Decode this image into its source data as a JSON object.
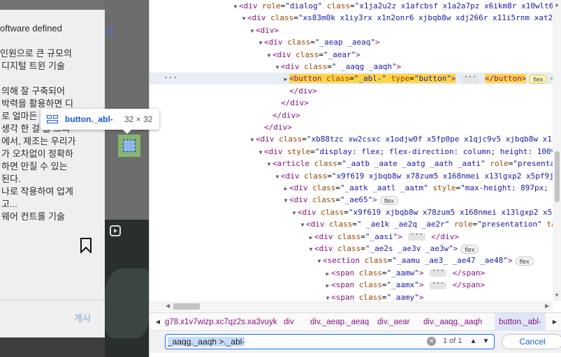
{
  "post": {
    "lines": [
      "oftware defined",
      "인원으로 큰 규모의",
      "디지털 트윈 기술",
      "의해 잘 구축되어",
      "박력을 활용하면 디",
      "로 얼마든",
      "생각 한 걸 을 그리",
      "에서, 제조는 우리가",
      "가 오차없이 정확하",
      "하면 만질 수 있는",
      "된다.",
      "나로 작용하여 업계",
      "고...",
      "웨어 컨트롤 기술"
    ],
    "side_glyph": "에",
    "post_button": "게시"
  },
  "tooltip": {
    "element": "button._abl-",
    "size": "32 × 32"
  },
  "dom": {
    "rows": [
      {
        "indent": 8,
        "tri": "▼",
        "html": "<span class=\"tag\">&lt;div</span> <span class=\"an\">role</span>=<span class=\"av\">\"dialog\"</span> <span class=\"an\">class</span>=<span class=\"av\">\"x1ja2u2z x1afcbsf x1a2a7pz x6ikm8r x10wlt6</span>"
      },
      {
        "indent": 20,
        "tri": "▼",
        "html": "<span class=\"tag\">&lt;div</span> <span class=\"an\">class</span>=<span class=\"av\">\"xs83m0k x1iy3rx x1n2onr6 xjbqb8w xdj266r x11i5rnm xat24</span>"
      },
      {
        "indent": 32,
        "tri": "▼",
        "html": "<span class=\"tag\">&lt;div&gt;</span>"
      },
      {
        "indent": 44,
        "tri": "▼",
        "html": "<span class=\"tag\">&lt;div</span> <span class=\"an\">class</span>=<span class=\"av\">\"_aeap _aeaq\"</span><span class=\"tag\">&gt;</span>"
      },
      {
        "indent": 56,
        "tri": "▼",
        "html": "<span class=\"tag\">&lt;div</span> <span class=\"an\">class</span>=<span class=\"av\">\"_aear\"</span><span class=\"tag\">&gt;</span>"
      },
      {
        "indent": 68,
        "tri": "▼",
        "html": "<span class=\"tag\">&lt;div</span> <span class=\"an\">class</span>=<span class=\"av\">\" _aaqg _aaqh\"</span><span class=\"tag\">&gt;</span>"
      },
      {
        "indent": 80,
        "tri": "▶",
        "sel": true,
        "html": "<span class=\"selbtn\"><span class=\"tag\">&lt;button</span> <span class=\"an\">class</span>=<span class=\"av\">\"_abl-\"</span> <span class=\"an\">type</span>=<span class=\"av\">\"button\"</span><span class=\"tag\">&gt;</span></span> <span class=\"dots\">···</span> <span class=\"selbtn\"><span class=\"tag\">&lt;/button&gt;</span></span><span class=\"pill flex-sel\">flex</span><span class=\"eqsign\">== $0</span>"
      },
      {
        "indent": 80,
        "tri": "",
        "html": "<span class=\"tag\">&lt;/div&gt;</span>"
      },
      {
        "indent": 68,
        "tri": "",
        "html": "<span class=\"tag\">&lt;/div&gt;</span>"
      },
      {
        "indent": 56,
        "tri": "",
        "html": "<span class=\"tag\">&lt;/div&gt;</span>"
      },
      {
        "indent": 44,
        "tri": "",
        "html": "<span class=\"tag\">&lt;/div&gt;</span>"
      },
      {
        "indent": 32,
        "tri": "▼",
        "html": "<span class=\"tag\">&lt;div</span> <span class=\"an\">class</span>=<span class=\"av\">\"xb88tzc xw2csxc x1odjw0f x5fp0pe x1qjc9v5 xjbqb8w x1l</span>"
      },
      {
        "indent": 44,
        "tri": "▼",
        "html": "<span class=\"tag\">&lt;div</span> <span class=\"an\">style</span>=<span class=\"av\">\"display: flex; flex-direction: column; height: 100%</span>"
      },
      {
        "indent": 56,
        "tri": "▼",
        "html": "<span class=\"tag\">&lt;article</span> <span class=\"an\">class</span>=<span class=\"av\">\"_aatb _aate _aatg _aath _aati\"</span> <span class=\"an\">role</span>=<span class=\"av\">\"presenta</span>"
      },
      {
        "indent": 68,
        "tri": "▼",
        "html": "<span class=\"tag\">&lt;div</span> <span class=\"an\">class</span>=<span class=\"av\">\"x9f619 xjbqb8w x78zum5 x168nmei x13lgxp2 x5pf9j</span>"
      },
      {
        "indent": 80,
        "tri": "▶",
        "html": "<span class=\"tag\">&lt;div</span> <span class=\"an\">class</span>=<span class=\"av\">\"_aatk _aatl _aatm\"</span> <span class=\"an\">style</span>=<span class=\"av\">\"max-height: 897px; m</span>"
      },
      {
        "indent": 80,
        "tri": "▼",
        "html": "<span class=\"tag\">&lt;div</span> <span class=\"an\">class</span>=<span class=\"av\">\"_ae65\"</span><span class=\"tag\">&gt;</span><span class=\"pill\">flex</span>"
      },
      {
        "indent": 92,
        "tri": "▼",
        "html": "<span class=\"tag\">&lt;div</span> <span class=\"an\">class</span>=<span class=\"av\">\"x9f619 xjbqb8w x78zum5 x168nmei x13lgxp2 x5p</span>"
      },
      {
        "indent": 104,
        "tri": "▼",
        "html": "<span class=\"tag\">&lt;div</span> <span class=\"an\">class</span>=<span class=\"av\">\" _ae1k _ae2q _ae2r\"</span> <span class=\"an\">role</span>=<span class=\"av\">\"presentation\"</span> <span class=\"an\">ta</span>"
      },
      {
        "indent": 116,
        "tri": "▶",
        "html": "<span class=\"tag\">&lt;div</span> <span class=\"an\">class</span>=<span class=\"av\">\"_aasi\"</span><span class=\"tag\">&gt;</span> <span class=\"dots\">···</span> <span class=\"tag\">&lt;/div&gt;</span>"
      },
      {
        "indent": 116,
        "tri": "▼",
        "html": "<span class=\"tag\">&lt;div</span> <span class=\"an\">class</span>=<span class=\"av\">\"_ae2s _ae3v _ae3w\"</span><span class=\"tag\">&gt;</span><span class=\"pill\">flex</span>"
      },
      {
        "indent": 128,
        "tri": "▼",
        "html": "<span class=\"tag\">&lt;section</span> <span class=\"an\">class</span>=<span class=\"av\">\"_aamu _ae3_ _ae47 _ae48\"</span><span class=\"tag\">&gt;</span><span class=\"pill\">flex</span>"
      },
      {
        "indent": 140,
        "tri": "▶",
        "html": "<span class=\"tag\">&lt;span</span> <span class=\"an\">class</span>=<span class=\"av\">\"_aamw\"</span><span class=\"tag\">&gt;</span> <span class=\"dots\">···</span> <span class=\"tag\">&lt;/span&gt;</span>"
      },
      {
        "indent": 140,
        "tri": "▶",
        "html": "<span class=\"tag\">&lt;span</span> <span class=\"an\">class</span>=<span class=\"av\">\"_aamx\"</span><span class=\"tag\">&gt;</span> <span class=\"dots\">···</span> <span class=\"tag\">&lt;/span&gt;</span>"
      },
      {
        "indent": 140,
        "tri": "▼",
        "html": "<span class=\"tag\">&lt;span</span> <span class=\"an\">class</span>=<span class=\"av\">\"_aamy\"</span><span class=\"tag\">&gt;</span>"
      }
    ],
    "ellipsis": "···"
  },
  "breadcrumb": {
    "items": [
      "g78.x1v7wizp.xc7qz2s.xa3vuyk",
      "div",
      "div._aeap._aeaq",
      "div._aear",
      "div._aaqg._aaqh",
      "button._abl-"
    ],
    "prev_icon": "◀",
    "next_icon": "▶"
  },
  "search": {
    "value": "_aaqg._aaqh >._abl-",
    "count": "1 of 1",
    "cancel_label": "Cancel"
  },
  "icons": [
    "reel-icon",
    "bookmark-icon",
    "element-inspect-icon",
    "search-clear-icon",
    "arrow-up-icon",
    "arrow-down-icon"
  ],
  "colors": {
    "selected_node": "#fdd545",
    "tag": "#881280",
    "attr_name": "#994500",
    "attr_value": "#1a1aa6",
    "accent": "#1a73e8"
  }
}
